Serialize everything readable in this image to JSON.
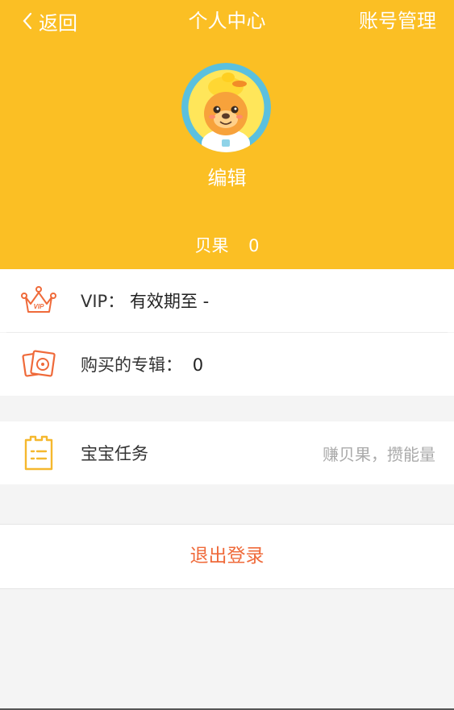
{
  "nav": {
    "back_label": "返回",
    "title": "个人中心",
    "account_label": "账号管理"
  },
  "profile": {
    "edit_label": "编辑",
    "beiguo_label": "贝果",
    "beiguo_count": "0"
  },
  "menu": {
    "vip": {
      "label": "VIP：",
      "value": "有效期至 -"
    },
    "albums": {
      "label": "购买的专辑：",
      "value": "0"
    },
    "tasks": {
      "label": "宝宝任务",
      "hint": "赚贝果，攒能量"
    }
  },
  "logout_label": "退出登录",
  "colors": {
    "header": "#fbbf24",
    "accent_red": "#ef6a3a",
    "task_icon": "#f5b82e"
  }
}
